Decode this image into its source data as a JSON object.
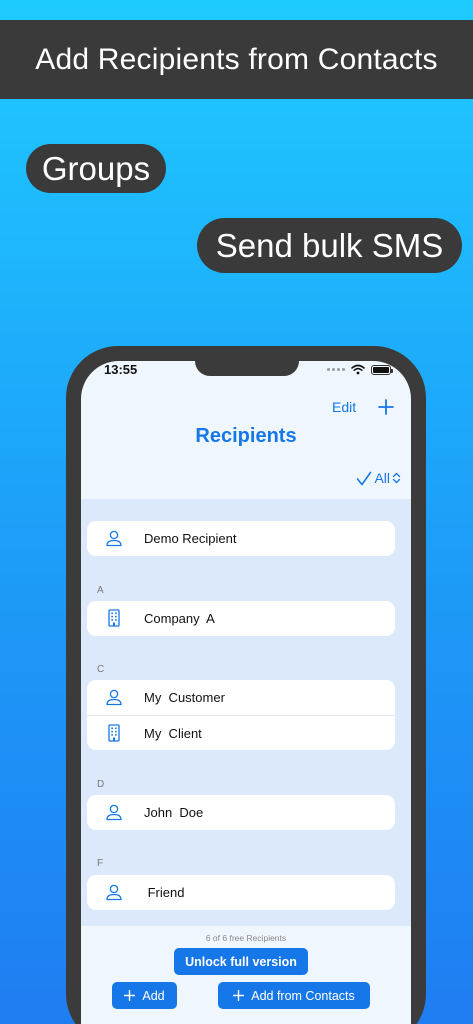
{
  "promo": {
    "banner": "Add Recipients from Contacts",
    "pill_groups": "Groups",
    "pill_sms": "Send bulk SMS"
  },
  "status": {
    "time": "13:55"
  },
  "nav": {
    "edit_label": "Edit",
    "title": "Recipients",
    "filter_label": "All"
  },
  "list": {
    "top_item": "Demo Recipient",
    "sections": [
      {
        "letter": "A",
        "items": [
          "Company  A"
        ]
      },
      {
        "letter": "C",
        "items": [
          "My  Customer",
          "My  Client"
        ]
      },
      {
        "letter": "D",
        "items": [
          "John  Doe"
        ]
      },
      {
        "letter": "F",
        "items": [
          " Friend"
        ]
      }
    ]
  },
  "footer": {
    "free_count": "6 of 6 free Recipients",
    "unlock_label": "Unlock full version",
    "add_label": "Add",
    "add_contacts_label": "Add from Contacts"
  },
  "colors": {
    "accent": "#1677e8",
    "banner_bg": "#3a3a3a",
    "list_bg": "#dbe9fb"
  },
  "icons": {
    "person": "person-icon",
    "building": "building-icon",
    "plus": "plus-icon",
    "checkmark": "checkmark-icon",
    "wifi": "wifi-icon",
    "battery": "battery-icon"
  }
}
